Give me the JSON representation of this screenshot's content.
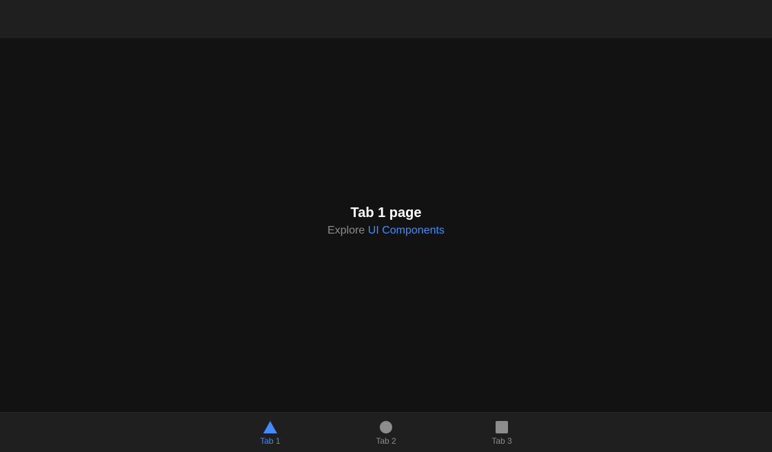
{
  "header": {},
  "main": {
    "title": "Tab 1 page",
    "subtitle_prefix": "Explore",
    "subtitle_link": "UI Components"
  },
  "tabs": [
    {
      "label": "Tab 1",
      "icon": "triangle-icon",
      "selected": true
    },
    {
      "label": "Tab 2",
      "icon": "ellipse-icon",
      "selected": false
    },
    {
      "label": "Tab 3",
      "icon": "square-icon",
      "selected": false
    }
  ],
  "colors": {
    "accent": "#428cff",
    "inactive": "#8c8c8c",
    "background": "#121212",
    "toolbar": "#1f1f1f"
  }
}
